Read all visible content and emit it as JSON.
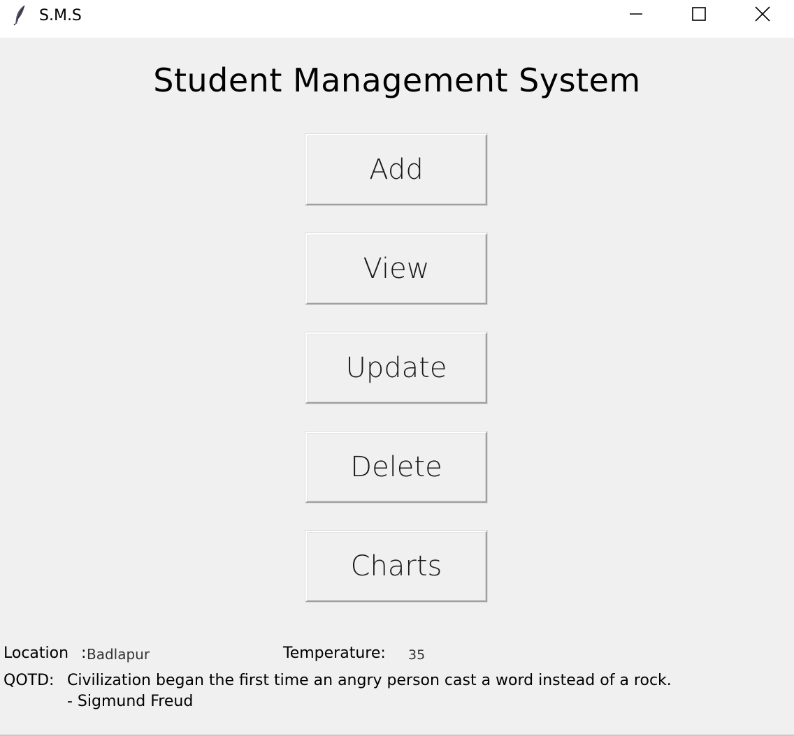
{
  "window": {
    "title": "S.M.S",
    "controls": {
      "minimize_icon": "minimize-icon",
      "maximize_icon": "maximize-icon",
      "close_icon": "close-icon"
    },
    "app_icon": "feather-icon"
  },
  "header": {
    "title": "Student Management System"
  },
  "actions": {
    "add": "Add",
    "view": "View",
    "update": "Update",
    "delete": "Delete",
    "charts": "Charts"
  },
  "footer": {
    "location_label": "Location",
    "location_separator": ":",
    "location_value": "Badlapur",
    "temperature_label": "Temperature:",
    "temperature_value": "35",
    "qotd_label": "QOTD:",
    "qotd_quote": "Civilization began the first time an angry person cast a word instead of a rock.",
    "qotd_author": "- Sigmund Freud"
  },
  "colors": {
    "background": "#f0f0f0",
    "titlebar": "#ffffff",
    "text": "#000000"
  }
}
